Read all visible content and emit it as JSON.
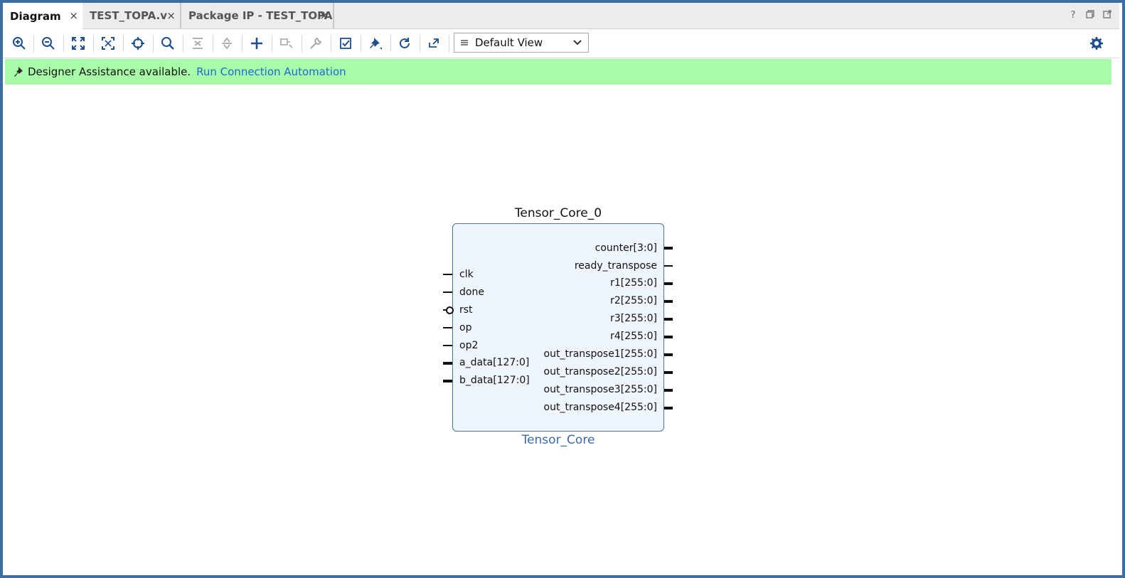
{
  "tabs": [
    {
      "label": "Diagram",
      "active": true
    },
    {
      "label": "TEST_TOPA.v",
      "active": false
    },
    {
      "label": "Package IP - TEST_TOPA",
      "active": false
    }
  ],
  "window_controls": [
    "?",
    "restore-icon",
    "float-icon"
  ],
  "toolbar": {
    "buttons": [
      "zoom-in-icon",
      "zoom-out-icon",
      "fit-icon",
      "fit-selection-icon",
      "autofit-icon",
      "search-icon",
      "collapse-icon",
      "expand-icon",
      "add-ip-icon",
      "make-connection-icon",
      "properties-icon",
      "validate-icon",
      "pin-icon",
      "regenerate-icon",
      "optimize-icon",
      "settings-icon"
    ],
    "view_select": "Default View"
  },
  "banner": {
    "message": "Designer Assistance available.",
    "link": "Run Connection Automation",
    "color": "#a8fca8"
  },
  "block": {
    "instance": "Tensor_Core_0",
    "module": "Tensor_Core",
    "inputs": [
      "clk",
      "done",
      "rst",
      "op",
      "op2",
      "a_data[127:0]",
      "b_data[127:0]"
    ],
    "outputs": [
      "counter[3:0]",
      "ready_transpose",
      "r1[255:0]",
      "r2[255:0]",
      "r3[255:0]",
      "r4[255:0]",
      "out_transpose1[255:0]",
      "out_transpose2[255:0]",
      "out_transpose3[255:0]",
      "out_transpose4[255:0]"
    ]
  }
}
